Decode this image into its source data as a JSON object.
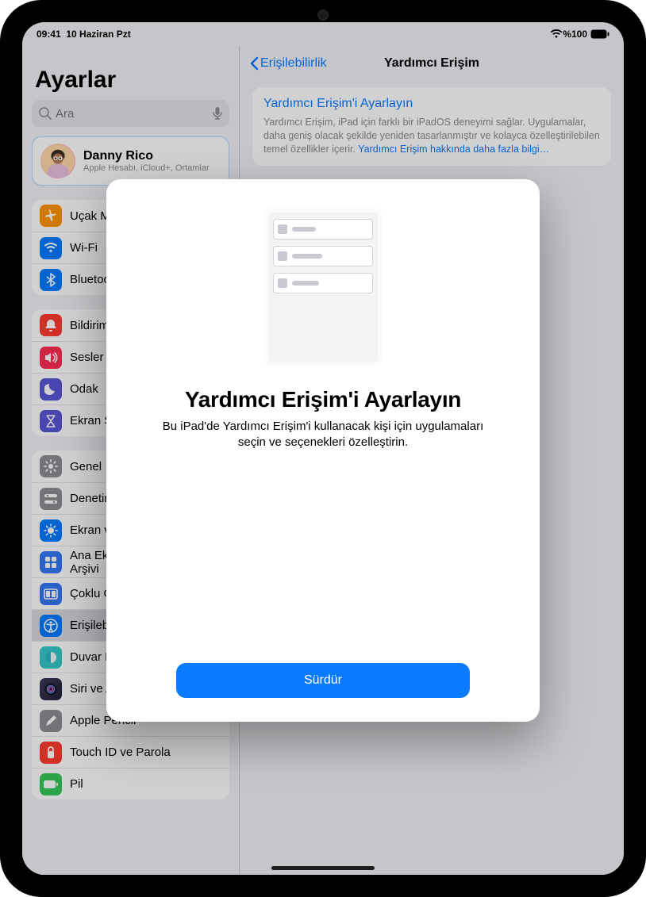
{
  "status": {
    "time_date": "09:41  10 Haziran Pzt",
    "battery": "%100"
  },
  "sidebar": {
    "title": "Ayarlar",
    "search_placeholder": "Ara",
    "account": {
      "name": "Danny Rico",
      "sub": "Apple Hesabı, iCloud+, Ortamlar"
    },
    "groups": [
      {
        "rows": [
          {
            "label": "Uçak Modu",
            "icon": "airplane-icon",
            "color": "c-orange"
          },
          {
            "label": "Wi-Fi",
            "icon": "wifi-icon",
            "color": "c-blue"
          },
          {
            "label": "Bluetooth",
            "icon": "bluetooth-icon",
            "color": "c-bt"
          }
        ]
      },
      {
        "rows": [
          {
            "label": "Bildirimler",
            "icon": "bell-icon",
            "color": "c-red"
          },
          {
            "label": "Sesler",
            "icon": "speaker-icon",
            "color": "c-pink"
          },
          {
            "label": "Odak",
            "icon": "moon-icon",
            "color": "c-indigo"
          },
          {
            "label": "Ekran Süresi",
            "icon": "hourglass-icon",
            "color": "c-hour"
          }
        ]
      },
      {
        "rows": [
          {
            "label": "Genel",
            "icon": "gear-icon",
            "color": "c-gray"
          },
          {
            "label": "Denetim Merkezi",
            "icon": "switches-icon",
            "color": "c-gray"
          },
          {
            "label": "Ekran ve Parlaklık",
            "icon": "brightness-icon",
            "color": "c-display"
          },
          {
            "label": "Ana Ekran ve Uygulama Arşivi",
            "icon": "grid-icon",
            "color": "c-home"
          },
          {
            "label": "Çoklu Görev ve Hareketler",
            "icon": "multitask-icon",
            "color": "c-ctrl"
          },
          {
            "label": "Erişilebilirlik",
            "icon": "accessibility-icon",
            "color": "c-acc",
            "selected": true
          },
          {
            "label": "Duvar Kâğıdı",
            "icon": "wallpaper-icon",
            "color": "c-wall"
          },
          {
            "label": "Siri ve Arama",
            "icon": "siri-icon",
            "color": "c-siri"
          },
          {
            "label": "Apple Pencil",
            "icon": "pencil-icon",
            "color": "c-pencil"
          },
          {
            "label": "Touch ID ve Parola",
            "icon": "touchid-icon",
            "color": "c-touch"
          },
          {
            "label": "Pil",
            "icon": "battery-icon",
            "color": "c-batt"
          }
        ]
      }
    ]
  },
  "detail": {
    "back": "Erişilebilirlik",
    "title": "Yardımcı Erişim",
    "setup_link": "Yardımcı Erişim'i Ayarlayın",
    "desc_pre": "Yardımcı Erişim, iPad için farklı bir iPadOS deneyimi sağlar. Uygulamalar, daha geniş olacak şekilde yeniden tasarlanmıştır ve kolayca özelleştirilebilen temel özellikler içerir. ",
    "desc_link": "Yardımcı Erişim hakkında daha fazla bilgi…"
  },
  "modal": {
    "title": "Yardımcı Erişim'i Ayarlayın",
    "body": "Bu iPad'de Yardımcı Erişim'i kullanacak kişi için uygulamaları seçin ve seçenekleri özelleştirin.",
    "continue": "Sürdür"
  }
}
